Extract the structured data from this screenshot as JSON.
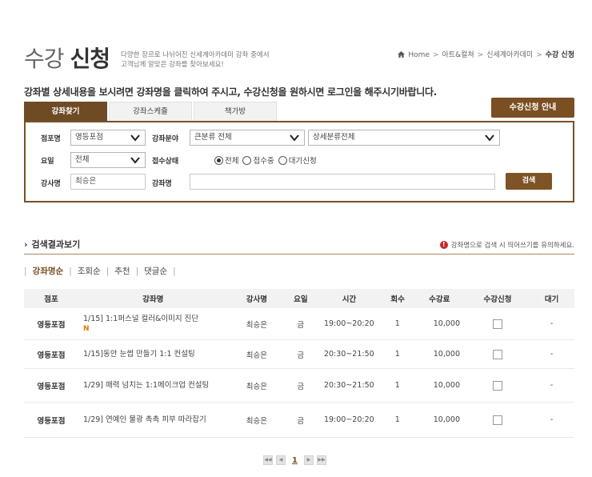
{
  "header": {
    "title_light": "수강",
    "title_bold": "신청",
    "subtitle_line1": "다양한 장르로 나뉘어진 신세계아카데미 강좌 중에서",
    "subtitle_line2": "고객님께 알맞은 강좌를 찾아보세요!",
    "breadcrumb": [
      "Home",
      "아트&컬쳐",
      "신세계아카데미",
      "수강 신청"
    ]
  },
  "notice": "강좌별 상세내용을 보시려면 강좌명을 클릭하여 주시고, 수강신청을 원하시면 로그인을 해주시기바랍니다.",
  "tabs": [
    {
      "label": "강좌찾기",
      "active": true
    },
    {
      "label": "강좌스케쥴",
      "active": false
    },
    {
      "label": "책가방",
      "active": false
    }
  ],
  "guide_button": "수강신청 안내",
  "search": {
    "store_label": "점포명",
    "store_value": "영등포점",
    "category_label": "강좌분야",
    "category_value": "큰분류 전체",
    "subcategory_value": "상세분류전체",
    "day_label": "요일",
    "day_value": "전체",
    "status_label": "접수상태",
    "status_options": [
      {
        "label": "전체",
        "checked": true
      },
      {
        "label": "접수중",
        "checked": false
      },
      {
        "label": "대기신청",
        "checked": false
      }
    ],
    "teacher_label": "강사명",
    "teacher_value": "최승은",
    "course_label": "강좌명",
    "course_value": "",
    "search_button": "검색"
  },
  "results": {
    "title": "검색결과보기",
    "note": "강좌명으로 검색 시 띄어쓰기를 유의하세요.",
    "sort_options": [
      "강좌명순",
      "조회순",
      "추천",
      "댓글순"
    ],
    "active_sort": "강좌명순",
    "columns": [
      "점포",
      "강좌명",
      "강사명",
      "요일",
      "시간",
      "회수",
      "수강료",
      "수강신청",
      "대기"
    ],
    "rows": [
      {
        "store": "영등포점",
        "course": "1/15] 1:1퍼스널 컬러&이미지 진단",
        "badge": "N",
        "teacher": "최승은",
        "day": "금",
        "time": "19:00~20:20",
        "count": "1",
        "fee": "10,000",
        "wait": "-"
      },
      {
        "store": "영등포점",
        "course": "1/15]동안 눈썹 만들기 1:1 컨설팅",
        "badge": "",
        "teacher": "최승은",
        "day": "금",
        "time": "20:30~21:50",
        "count": "1",
        "fee": "10,000",
        "wait": "-"
      },
      {
        "store": "영등포점",
        "course": "1/29] 매력 넘치는 1:1메이크업 컨설팅",
        "badge": "",
        "teacher": "최승은",
        "day": "금",
        "time": "20:30~21:50",
        "count": "1",
        "fee": "10,000",
        "wait": "-"
      },
      {
        "store": "영등포점",
        "course": "1/29] 연예인 물광 촉촉 피부 따라잡기",
        "badge": "",
        "teacher": "최승은",
        "day": "금",
        "time": "19:00~20:20",
        "count": "1",
        "fee": "10,000",
        "wait": "-"
      }
    ]
  },
  "pagination": {
    "first": "◀◀",
    "prev": "◀",
    "current": "1",
    "next": "▶",
    "last": "▶▶"
  },
  "colors": {
    "brand_brown": "#7a4f22",
    "tab_active": "#6e4a25",
    "new_badge": "#e27b00",
    "warning": "#c62828"
  }
}
